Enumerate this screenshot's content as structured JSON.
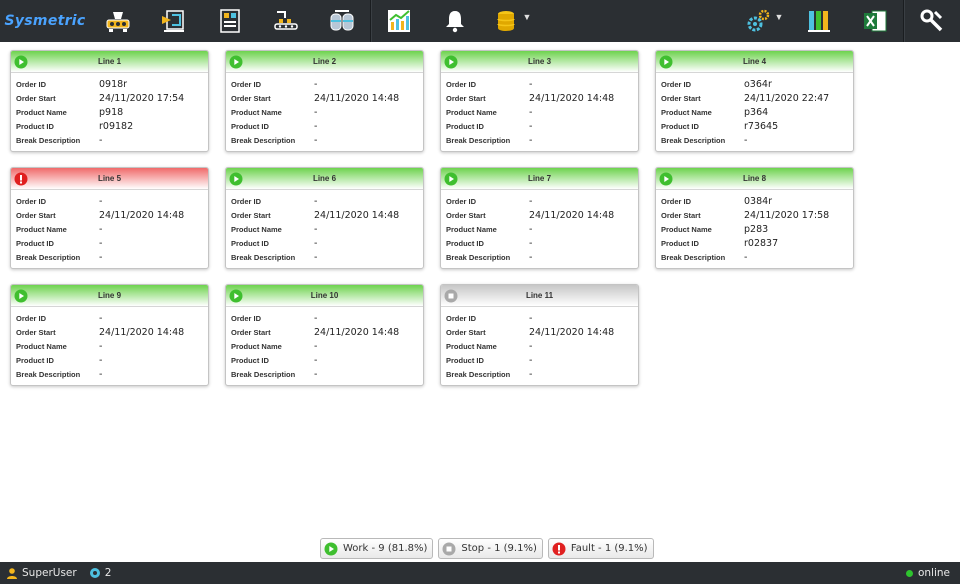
{
  "app": {
    "logo": "Sysmetric",
    "accent": "#4aa3ff",
    "toolbar": [
      {
        "name": "machine-icon"
      },
      {
        "name": "conveyor-icon"
      },
      {
        "name": "panel-icon"
      },
      {
        "name": "production-line-icon"
      },
      {
        "name": "tanks-icon"
      },
      {
        "name": "chart-icon"
      },
      {
        "name": "bell-icon"
      },
      {
        "name": "database-icon"
      },
      {
        "name": "settings-gears-icon"
      },
      {
        "name": "reports-icon"
      },
      {
        "name": "excel-icon"
      },
      {
        "name": "tools-icon"
      }
    ]
  },
  "labels": {
    "order_id": "Order ID",
    "order_start": "Order Start",
    "product_name": "Product Name",
    "product_id": "Product ID",
    "break_description": "Break Description"
  },
  "lines": [
    {
      "title": "Line 1",
      "status": "work",
      "order_id": "0918r",
      "order_start": "24/11/2020 17:54",
      "product_name": "p918",
      "product_id": "r09182",
      "break_description": "-"
    },
    {
      "title": "Line 2",
      "status": "work",
      "order_id": "-",
      "order_start": "24/11/2020 14:48",
      "product_name": "-",
      "product_id": "-",
      "break_description": "-"
    },
    {
      "title": "Line 3",
      "status": "work",
      "order_id": "-",
      "order_start": "24/11/2020 14:48",
      "product_name": "-",
      "product_id": "-",
      "break_description": "-"
    },
    {
      "title": "Line 4",
      "status": "work",
      "order_id": "o364r",
      "order_start": "24/11/2020 22:47",
      "product_name": "p364",
      "product_id": "r73645",
      "break_description": "-"
    },
    {
      "title": "Line 5",
      "status": "fault",
      "order_id": "-",
      "order_start": "24/11/2020 14:48",
      "product_name": "-",
      "product_id": "-",
      "break_description": "-"
    },
    {
      "title": "Line 6",
      "status": "work",
      "order_id": "-",
      "order_start": "24/11/2020 14:48",
      "product_name": "-",
      "product_id": "-",
      "break_description": "-"
    },
    {
      "title": "Line 7",
      "status": "work",
      "order_id": "-",
      "order_start": "24/11/2020 14:48",
      "product_name": "-",
      "product_id": "-",
      "break_description": "-"
    },
    {
      "title": "Line 8",
      "status": "work",
      "order_id": "0384r",
      "order_start": "24/11/2020 17:58",
      "product_name": "p283",
      "product_id": "r02837",
      "break_description": "-"
    },
    {
      "title": "Line 9",
      "status": "work",
      "order_id": "-",
      "order_start": "24/11/2020 14:48",
      "product_name": "-",
      "product_id": "-",
      "break_description": "-"
    },
    {
      "title": "Line 10",
      "status": "work",
      "order_id": "-",
      "order_start": "24/11/2020 14:48",
      "product_name": "-",
      "product_id": "-",
      "break_description": "-"
    },
    {
      "title": "Line 11",
      "status": "stop",
      "order_id": "-",
      "order_start": "24/11/2020 14:48",
      "product_name": "-",
      "product_id": "-",
      "break_description": "-"
    }
  ],
  "summary": {
    "work": "Work - 9 (81.8%)",
    "stop": "Stop - 1 (9.1%)",
    "fault": "Fault - 1 (9.1%)"
  },
  "status_colors": {
    "work": "#3fbf2f",
    "stop": "#a9a9a9",
    "fault": "#e02020"
  },
  "statusbar": {
    "user": "SuperUser",
    "sessions": "2",
    "connection": "online"
  }
}
